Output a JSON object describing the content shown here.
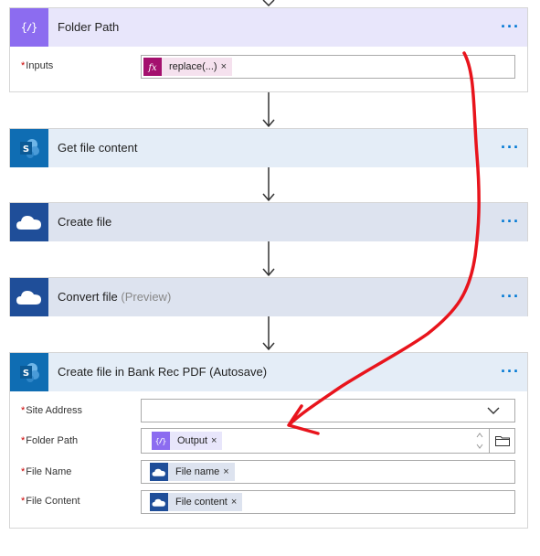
{
  "cards": {
    "folder_path": {
      "title": "Folder Path",
      "inputs_label": "Inputs",
      "token": "replace(...)"
    },
    "get_file_content": {
      "title": "Get file content"
    },
    "create_file": {
      "title": "Create file"
    },
    "convert_file": {
      "title": "Convert file",
      "subtitle": "(Preview)"
    },
    "create_file_bank": {
      "title": "Create file in Bank Rec PDF (Autosave)",
      "site_address_label": "Site Address",
      "folder_path_label": "Folder Path",
      "folder_path_token": "Output",
      "file_name_label": "File Name",
      "file_name_token": "File name",
      "file_content_label": "File Content",
      "file_content_token": "File content"
    }
  },
  "common": {
    "more": "···",
    "required": "*",
    "remove": "×"
  },
  "colors": {
    "variable_header": "#e8e6fb",
    "variable_icon": "#8c6cf0",
    "sharepoint_header": "#e4edf7",
    "sharepoint_icon": "#0f6db3",
    "onedrive_header": "#dde3ef",
    "onedrive_icon": "#1f4e99",
    "expression_icon": "#a4106e",
    "annotation": "#e8141c"
  },
  "icons": [
    "variable-icon",
    "sharepoint-icon",
    "onedrive-icon",
    "expression-icon",
    "chevron-down-icon",
    "folder-icon",
    "spin-arrows-icon"
  ]
}
